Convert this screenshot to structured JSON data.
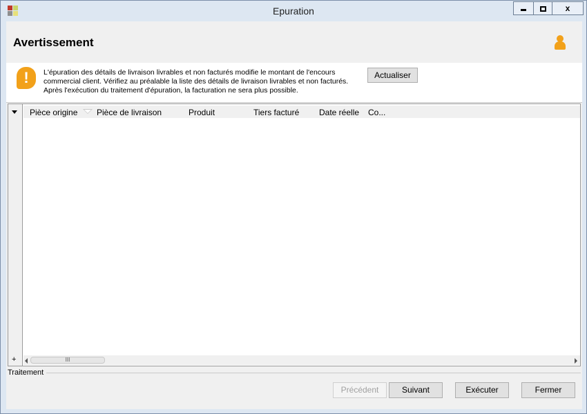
{
  "window": {
    "title": "Epuration",
    "icons": {
      "app": "app-icon",
      "minimize": "minimize-icon",
      "maximize": "maximize-icon",
      "close": "close-icon"
    },
    "close_label": "x"
  },
  "header": {
    "title": "Avertissement",
    "user_icon": "user-icon"
  },
  "warning": {
    "icon_glyph": "!",
    "lines": [
      "L'épuration des détails de livraison livrables et non facturés modifie le montant de l'encours",
      "commercial client. Vérifiez au préalable la liste des détails de livraison livrables et non facturés.",
      "Après l'exécution du traitement d'épuration, la facturation ne sera plus possible."
    ],
    "refresh_label": "Actualiser"
  },
  "grid": {
    "columns": [
      "Pièce origine",
      "Pièce de livraison",
      "Produit",
      "Tiers facturé",
      "Date réelle",
      "Co..."
    ],
    "rows": [],
    "add_glyph": "+",
    "thumb_glyph": "III"
  },
  "footer": {
    "group_label": "Traitement",
    "buttons": {
      "previous": "Précédent",
      "next": "Suivant",
      "execute": "Exécuter",
      "close": "Fermer"
    }
  },
  "colors": {
    "warning_accent": "#f2a11a",
    "title_bar": "#dde7f2"
  }
}
